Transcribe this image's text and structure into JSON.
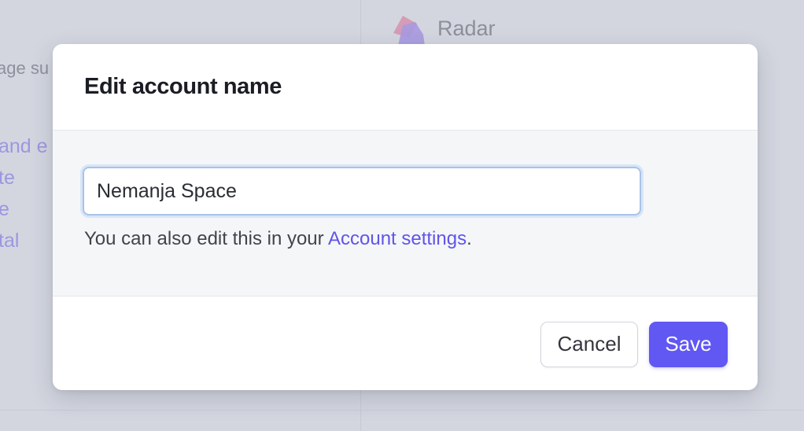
{
  "background": {
    "faded_text": "age su",
    "links": [
      "and e",
      "te",
      "e",
      "tal"
    ],
    "brand": {
      "name": "Radar",
      "icon": "radar-logo-icon"
    }
  },
  "modal": {
    "title": "Edit account name",
    "input": {
      "value": "Nemanja Space",
      "placeholder": ""
    },
    "helper": {
      "prefix": "You can also edit this in your ",
      "link_label": "Account settings",
      "suffix": "."
    },
    "buttons": {
      "cancel_label": "Cancel",
      "save_label": "Save"
    }
  },
  "colors": {
    "accent": "#6157f2",
    "link": "#5f55e8",
    "overlay": "#d3d6df",
    "input_focus_border": "#a9c3e8"
  }
}
